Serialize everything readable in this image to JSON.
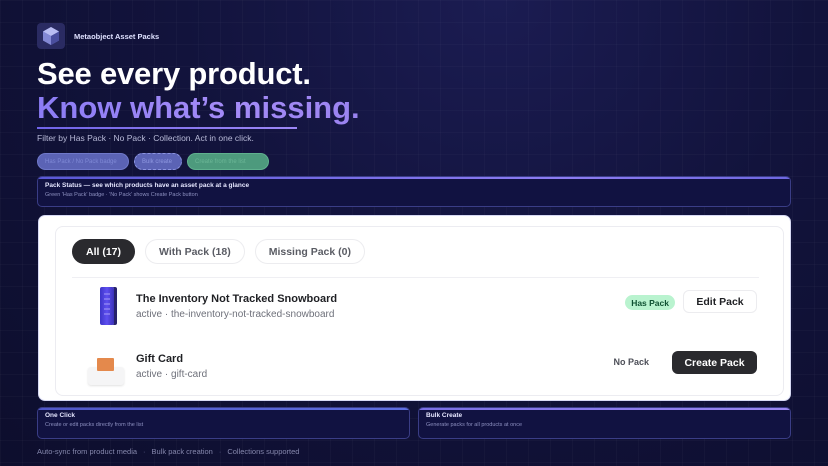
{
  "brand": {
    "name": "Metaobject Asset Packs",
    "logo_icon": "cube-crystal-icon"
  },
  "hero": {
    "headline_line1": "See every product.",
    "headline_line2": "Know what’s missing.",
    "subtitle": "Filter by Has Pack · No Pack · Collection. Act in one click."
  },
  "chips": [
    {
      "label": "Has Pack / No Pack badge"
    },
    {
      "label": "Bulk create"
    },
    {
      "label": "Create from the list"
    }
  ],
  "status_card": {
    "title": "Pack Status — see which products have an asset pack at a glance",
    "description": "Green 'Has Pack' badge · 'No Pack' shows Create Pack button"
  },
  "app": {
    "tabs": [
      {
        "label": "All (17)",
        "active": true
      },
      {
        "label": "With Pack (18)",
        "active": false
      },
      {
        "label": "Missing Pack (0)",
        "active": false
      }
    ],
    "products": [
      {
        "name": "The Inventory Not Tracked Snowboard",
        "meta": "active · the-inventory-not-tracked-snowboard",
        "status": "Has Pack",
        "action": "Edit Pack",
        "thumb_icon": "snowboard-icon"
      },
      {
        "name": "Gift Card",
        "meta": "active · gift-card",
        "status": "No Pack",
        "action": "Create Pack",
        "thumb_icon": "gift-card-icon"
      }
    ]
  },
  "features": [
    {
      "title": "One Click",
      "description": "Create or edit packs directly from the list"
    },
    {
      "title": "Bulk Create",
      "description": "Generate packs for all products at once"
    }
  ],
  "footer": {
    "items": [
      "Auto-sync from product media",
      "Bulk pack creation",
      "Collections supported"
    ],
    "separator": "·"
  },
  "colors": {
    "background": "#12133c",
    "accent": "#8b7cf5",
    "has_pack_badge": "#b9f3cf",
    "primary_button": "#2a2a2e"
  }
}
